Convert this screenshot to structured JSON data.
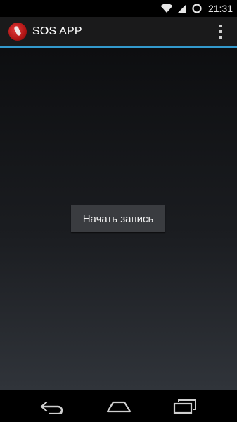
{
  "status_bar": {
    "time": "21:31",
    "icons": [
      "wifi-icon",
      "signal-icon",
      "sync-icon"
    ]
  },
  "action_bar": {
    "title": "SOS APP",
    "app_icon": "microphone-app-icon",
    "overflow_icon": "overflow-menu-icon",
    "accent_color": "#3399cc"
  },
  "main": {
    "record_button_label": "Начать запись"
  },
  "nav_bar": {
    "buttons": [
      "back-icon",
      "home-icon",
      "recents-icon"
    ]
  }
}
